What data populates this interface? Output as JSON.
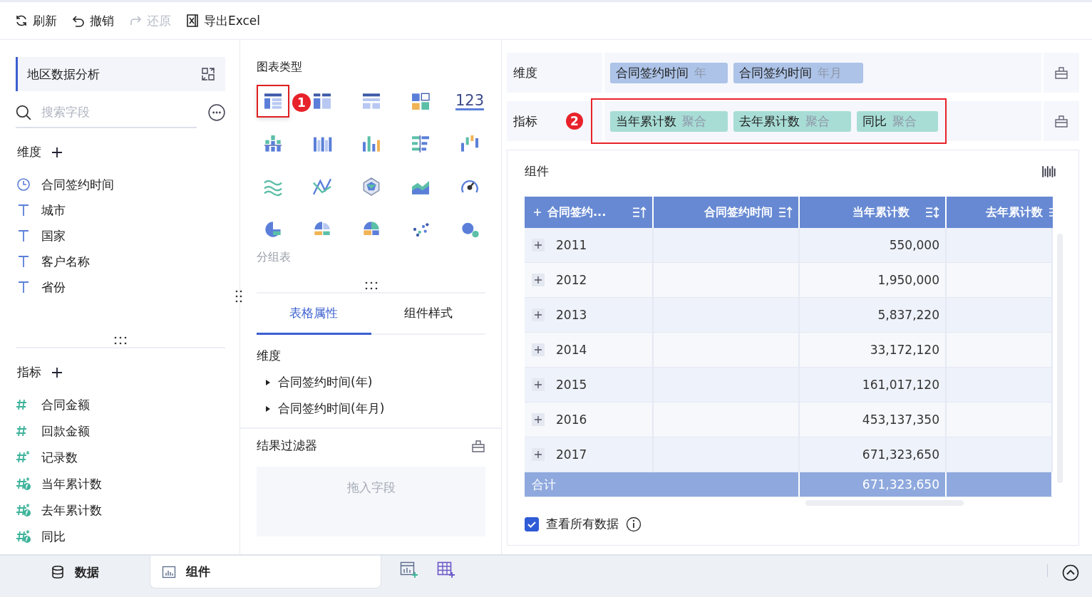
{
  "toolbar": [
    {
      "label": "刷新",
      "kind": "refresh",
      "disabled": false
    },
    {
      "label": "撤销",
      "kind": "undo",
      "disabled": false
    },
    {
      "label": "还原",
      "kind": "redo",
      "disabled": true
    },
    {
      "label": "导出Excel",
      "kind": "excel",
      "disabled": false
    }
  ],
  "dataset": {
    "title": "地区数据分析"
  },
  "search": {
    "placeholder": "搜索字段"
  },
  "dimensions": {
    "title": "维度",
    "fields": [
      {
        "name": "合同签约时间",
        "kind": "time"
      },
      {
        "name": "城市",
        "kind": "text"
      },
      {
        "name": "国家",
        "kind": "text"
      },
      {
        "name": "客户名称",
        "kind": "text"
      },
      {
        "name": "省份",
        "kind": "text"
      }
    ]
  },
  "metrics": {
    "title": "指标",
    "fields": [
      {
        "name": "合同金额",
        "kind": "number"
      },
      {
        "name": "回款金额",
        "kind": "number"
      },
      {
        "name": "记录数",
        "kind": "count"
      },
      {
        "name": "当年累计数",
        "kind": "calc"
      },
      {
        "name": "去年累计数",
        "kind": "calc"
      },
      {
        "name": "同比",
        "kind": "calc"
      }
    ]
  },
  "chart_types": {
    "title": "图表类型",
    "kpi_text": "123",
    "badge": "1",
    "hover_label": "分组表",
    "items": [
      {
        "selected": true
      },
      {
        "selected": false
      },
      {
        "selected": false
      },
      {
        "selected": false
      },
      {
        "selected": false
      },
      {
        "selected": false
      },
      {
        "selected": false
      },
      {
        "selected": false
      },
      {
        "selected": false
      },
      {
        "selected": false
      },
      {
        "selected": false
      },
      {
        "selected": false
      },
      {
        "selected": false
      },
      {
        "selected": false
      },
      {
        "selected": false
      },
      {
        "selected": false
      },
      {
        "selected": false
      },
      {
        "selected": false
      },
      {
        "selected": false
      },
      {
        "selected": false
      }
    ]
  },
  "prop_tabs": [
    {
      "label": "表格属性",
      "selected": true
    },
    {
      "label": "组件样式",
      "selected": false
    }
  ],
  "properties": {
    "title": "维度",
    "items": [
      {
        "label": "合同签约时间(年)"
      },
      {
        "label": "合同签约时间(年月)"
      }
    ]
  },
  "result_filter": {
    "title": "结果过滤器",
    "placeholder": "拖入字段"
  },
  "dimension_shelf": {
    "label": "维度",
    "pills": [
      {
        "name": "合同签约时间",
        "sub": "年"
      },
      {
        "name": "合同签约时间",
        "sub": "年月"
      }
    ]
  },
  "metric_shelf": {
    "label": "指标",
    "badge": "2",
    "pills": [
      {
        "name": "当年累计数",
        "sub": "聚合"
      },
      {
        "name": "去年累计数",
        "sub": "聚合"
      },
      {
        "name": "同比",
        "sub": "聚合"
      }
    ]
  },
  "component": {
    "title": "组件",
    "table": {
      "columns": [
        {
          "label": "合同签约..."
        },
        {
          "label": "合同签约时间"
        },
        {
          "label": "当年累计数"
        },
        {
          "label": "去年累计数"
        }
      ],
      "rows": [
        {
          "year": "2011",
          "value": "550,000"
        },
        {
          "year": "2012",
          "value": "1,950,000"
        },
        {
          "year": "2013",
          "value": "5,837,220"
        },
        {
          "year": "2014",
          "value": "33,172,120"
        },
        {
          "year": "2015",
          "value": "161,017,120"
        },
        {
          "year": "2016",
          "value": "453,137,350"
        },
        {
          "year": "2017",
          "value": "671,323,650"
        }
      ],
      "total": {
        "label": "合计",
        "value": "671,323,650"
      }
    },
    "view_all": {
      "label": "查看所有数据",
      "checked": true
    }
  },
  "bottom_tabs": [
    {
      "label": "数据",
      "kind": "data",
      "selected": false
    },
    {
      "label": "组件",
      "kind": "chart",
      "selected": true
    }
  ]
}
